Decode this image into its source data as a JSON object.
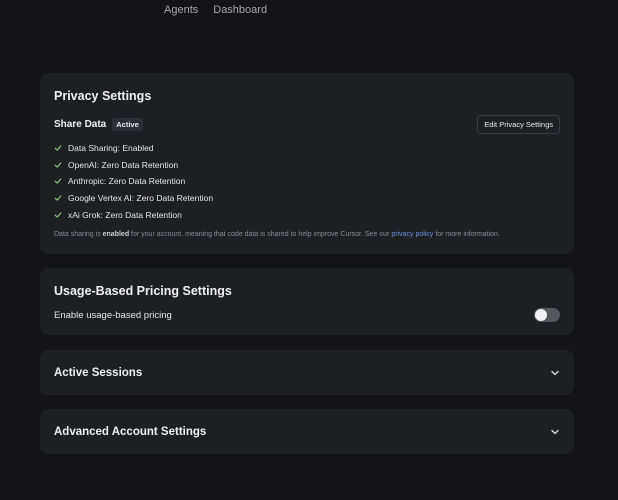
{
  "nav": {
    "agents": "Agents",
    "dashboard": "Dashboard"
  },
  "privacy": {
    "title": "Privacy Settings",
    "share_label": "Share Data",
    "badge": "Active",
    "edit_button": "Edit Privacy Settings",
    "items": [
      "Data Sharing: Enabled",
      "OpenAI: Zero Data Retention",
      "Anthropic: Zero Data Retention",
      "Google Vertex AI: Zero Data Retention",
      "xAi Grok: Zero Data Retention"
    ],
    "note_pre": "Data sharing is ",
    "note_bold": "enabled",
    "note_mid": " for your account, meaning that code data is shared to help improve Cursor. See our ",
    "note_link": "privacy policy",
    "note_post": " for more information."
  },
  "usage": {
    "title": "Usage-Based Pricing Settings",
    "toggle_label": "Enable usage-based pricing",
    "enabled": false
  },
  "sessions": {
    "title": "Active Sessions"
  },
  "advanced": {
    "title": "Advanced Account Settings"
  },
  "colors": {
    "check": "#8fce7a",
    "link": "#6e8fd9",
    "card": "#1e1f23",
    "background": "#141416"
  },
  "icons": {
    "check": "check-icon",
    "chevron": "chevron-down-icon"
  }
}
